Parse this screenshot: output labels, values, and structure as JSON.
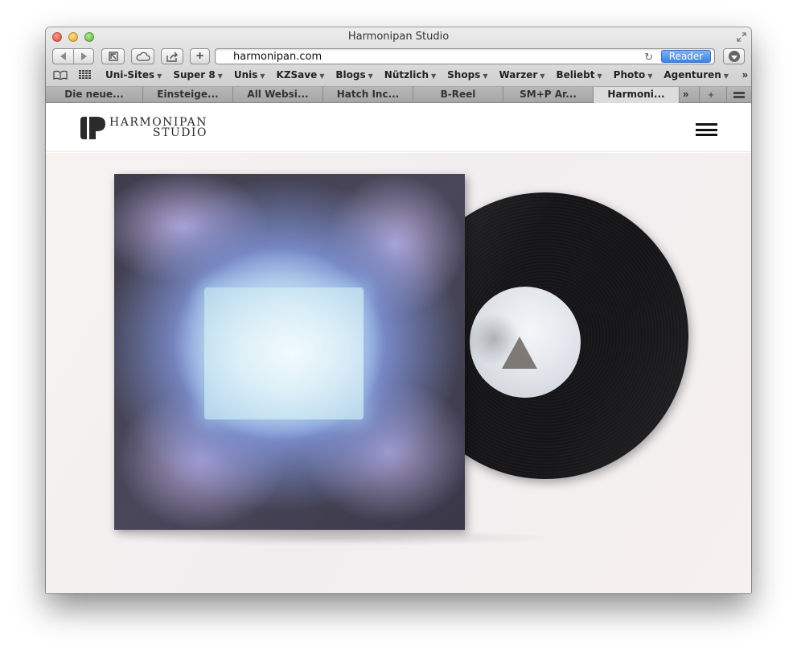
{
  "window": {
    "title": "Harmonipan Studio"
  },
  "toolbar": {
    "new_tab_label": "+",
    "address": "harmonipan.com",
    "reload_icon": "reload-icon",
    "reader_label": "Reader"
  },
  "bookmarks": {
    "items": [
      {
        "label": "Uni-Sites"
      },
      {
        "label": "Super 8"
      },
      {
        "label": "Unis"
      },
      {
        "label": "KZSave"
      },
      {
        "label": "Blogs"
      },
      {
        "label": "Nützlich"
      },
      {
        "label": "Shops"
      },
      {
        "label": "Warzer"
      },
      {
        "label": "Beliebt"
      },
      {
        "label": "Photo"
      },
      {
        "label": "Agenturen"
      }
    ]
  },
  "tabs": {
    "items": [
      {
        "label": "Die neue..."
      },
      {
        "label": "Einsteige..."
      },
      {
        "label": "All Websi..."
      },
      {
        "label": "Hatch Inc..."
      },
      {
        "label": "B-Reel"
      },
      {
        "label": "SM+P Ar..."
      },
      {
        "label": "Harmoni..."
      }
    ],
    "active_index": 6,
    "add_label": "+"
  },
  "site": {
    "logo_line1": "HARMONIPAN",
    "logo_line2": "STUDIO"
  },
  "colors": {
    "reader_blue": "#4a8ce6",
    "close_red": "#e0453a",
    "minimize_yellow": "#e5a323",
    "zoom_green": "#5aae36",
    "logo_dark": "#2b2b2b"
  }
}
